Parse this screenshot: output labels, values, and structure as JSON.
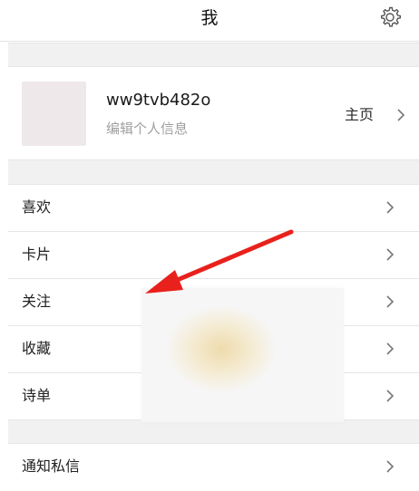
{
  "header": {
    "title": "我",
    "settings_icon": "gear-icon"
  },
  "profile": {
    "username": "ww9tvb482o",
    "edit_label": "编辑个人信息",
    "homepage_label": "主页",
    "avatar_color": "#eee8eb"
  },
  "menu": {
    "items": [
      {
        "label": "喜欢"
      },
      {
        "label": "卡片"
      },
      {
        "label": "关注"
      },
      {
        "label": "收藏"
      },
      {
        "label": "诗单"
      }
    ]
  },
  "menu2": {
    "items": [
      {
        "label": "通知私信"
      }
    ]
  },
  "colors": {
    "section_gap": "#f1f1f1",
    "divider": "#e6e6e6",
    "secondary_text": "#a0a0a0",
    "annotation_arrow": "#e8211c"
  },
  "annotation": {
    "type": "arrow",
    "color": "#e8211c"
  }
}
